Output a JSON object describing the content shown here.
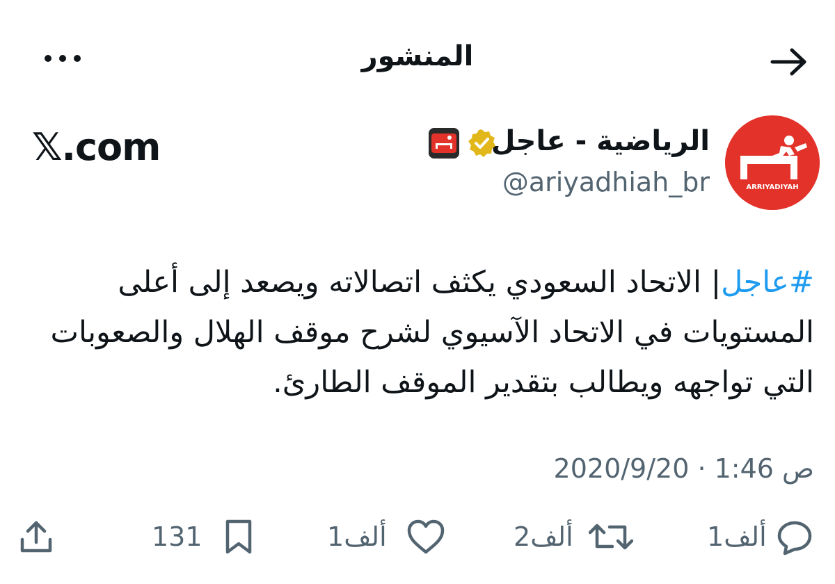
{
  "header": {
    "title": "المنشور",
    "back_icon": "arrow-icon",
    "more_icon": "more-horizontal-icon"
  },
  "author": {
    "display_name": "الرياضية - عاجل",
    "handle": "@ariyadhiah_br",
    "avatar_text": "ARRIYADIYAH",
    "verified": true,
    "verified_color": "#e2b719",
    "avatar_color": "#e23229"
  },
  "watermark": "𝕏.com",
  "tweet": {
    "hashtag": "#عاجل",
    "text": "| الاتحاد السعودي يكثف اتصالاته ويصعد إلى أعلى المستويات في الاتحاد الآسيوي لشرح موقف الهلال والصعوبات التي تواجهه ويطالب بتقدير الموقف الطارئ.",
    "hashtag_color": "#1d9bf0"
  },
  "timestamp": "2020/9/20 · 1:46 ص",
  "actions": {
    "reply": {
      "icon": "reply-icon",
      "count": "1ألف"
    },
    "retweet": {
      "icon": "retweet-icon",
      "count": "2ألف"
    },
    "like": {
      "icon": "heart-icon",
      "count": "1ألف"
    },
    "bookmark": {
      "icon": "bookmark-icon",
      "count": "131"
    },
    "share": {
      "icon": "share-icon"
    }
  }
}
